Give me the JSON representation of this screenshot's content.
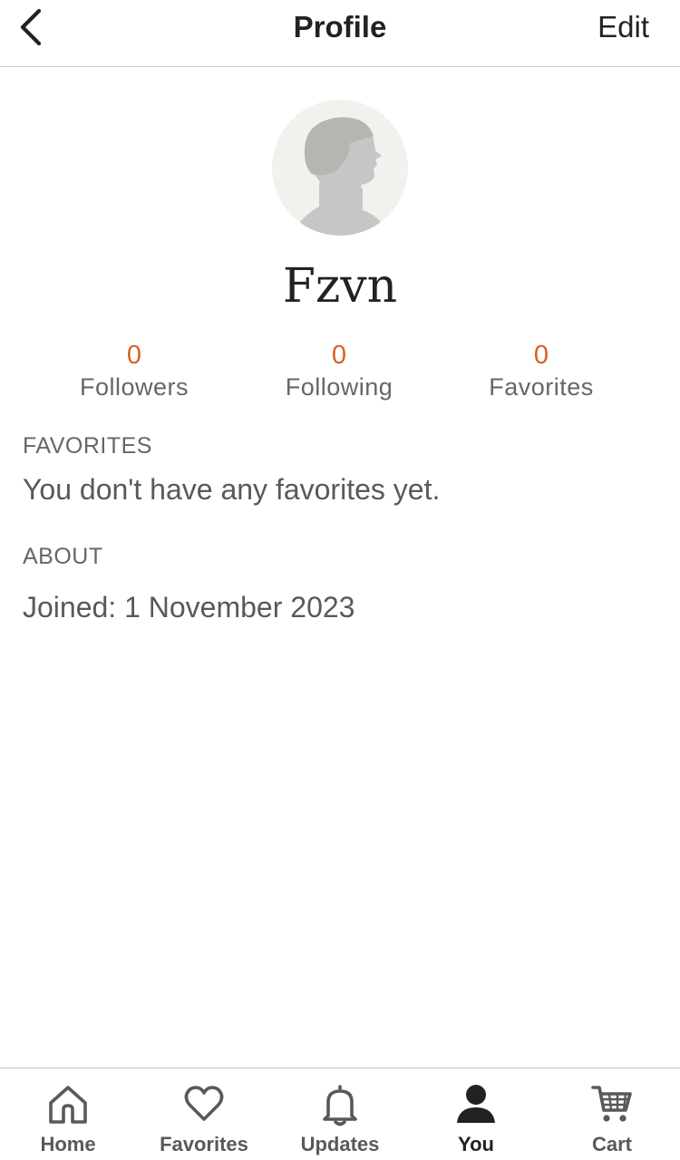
{
  "header": {
    "title": "Profile",
    "edit_label": "Edit",
    "back_icon": "chevron-left-icon"
  },
  "profile": {
    "username": "Fzvn",
    "avatar_icon": "default-avatar-silhouette"
  },
  "stats": [
    {
      "count": "0",
      "label": "Followers"
    },
    {
      "count": "0",
      "label": "Following"
    },
    {
      "count": "0",
      "label": "Favorites"
    }
  ],
  "favorites_section": {
    "heading": "FAVORITES",
    "empty_text": "You don't have any favorites yet."
  },
  "about_section": {
    "heading": "ABOUT",
    "joined_text": "Joined: 1 November 2023"
  },
  "bottom_nav": [
    {
      "label": "Home",
      "icon": "home-icon",
      "active": false
    },
    {
      "label": "Favorites",
      "icon": "heart-icon",
      "active": false
    },
    {
      "label": "Updates",
      "icon": "bell-icon",
      "active": false
    },
    {
      "label": "You",
      "icon": "person-icon",
      "active": true
    },
    {
      "label": "Cart",
      "icon": "cart-icon",
      "active": false
    }
  ],
  "colors": {
    "accent_orange": "#d5641c",
    "text_primary": "#222222",
    "text_secondary": "#595959",
    "divider": "#c8c8c8",
    "avatar_bg": "#f1f1ee",
    "avatar_figure": "#c6c6c6"
  }
}
